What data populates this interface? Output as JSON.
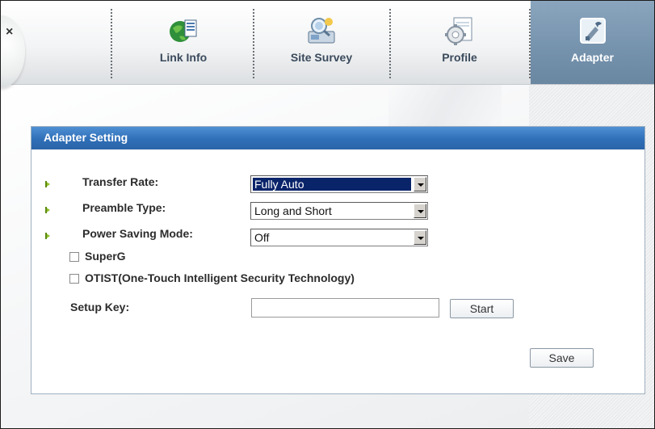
{
  "nav": {
    "tabs": [
      {
        "label": "Link Info",
        "icon": "globe-document-icon"
      },
      {
        "label": "Site Survey",
        "icon": "network-search-icon"
      },
      {
        "label": "Profile",
        "icon": "gear-document-icon"
      },
      {
        "label": "Adapter",
        "icon": "adapter-card-icon"
      }
    ],
    "active_tab": "Adapter"
  },
  "panel": {
    "title": "Adapter Setting",
    "transfer_rate": {
      "label": "Transfer Rate:",
      "value": "Fully Auto"
    },
    "preamble_type": {
      "label": "Preamble Type:",
      "value": "Long and Short"
    },
    "power_saving_mode": {
      "label": "Power Saving Mode:",
      "value": "Off"
    },
    "superg": {
      "label": "SuperG",
      "checked": false
    },
    "otist": {
      "label": "OTIST(One-Touch Intelligent Security Technology)",
      "checked": false
    },
    "setup_key": {
      "label": "Setup Key:",
      "value": ""
    },
    "start_label": "Start",
    "save_label": "Save"
  },
  "colors": {
    "header_blue": "#2f6fb8",
    "active_tab": "#7592ad",
    "arrow_green": "#8fc12a",
    "selection": "#0a246a"
  }
}
